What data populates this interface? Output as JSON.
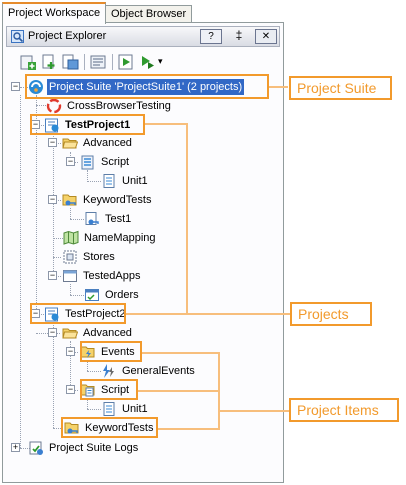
{
  "tabs": [
    {
      "label": "Project Workspace",
      "active": true
    },
    {
      "label": "Object Browser",
      "active": false
    }
  ],
  "panel": {
    "title": "Project Explorer",
    "help_label": "?",
    "pin_glyph": "‡",
    "close_glyph": "✕"
  },
  "toolbar": {
    "buttons": [
      "add-item-icon",
      "add-new-icon",
      "add-existing-icon",
      "properties-icon",
      "run-icon",
      "run-dropdown-icon"
    ],
    "dropdown_glyph": "▾"
  },
  "tree": {
    "suite": {
      "label": "Project Suite 'ProjectSuite1' (2 projects)",
      "expander": "−"
    },
    "crossbrowser": {
      "label": "CrossBrowserTesting"
    },
    "project1": {
      "label": "TestProject1",
      "expander": "−",
      "advanced": {
        "label": "Advanced",
        "expander": "−"
      },
      "script": {
        "label": "Script",
        "expander": "−"
      },
      "unit1": {
        "label": "Unit1"
      },
      "keywordtests": {
        "label": "KeywordTests",
        "expander": "−"
      },
      "test1": {
        "label": "Test1"
      },
      "namemapping": {
        "label": "NameMapping"
      },
      "stores": {
        "label": "Stores",
        "expander": "+"
      },
      "testedapps": {
        "label": "TestedApps",
        "expander": "−"
      },
      "orders": {
        "label": "Orders"
      }
    },
    "project2": {
      "label": "TestProject2",
      "expander": "−",
      "advanced": {
        "label": "Advanced",
        "expander": "−"
      },
      "events": {
        "label": "Events",
        "expander": "−"
      },
      "generalevents": {
        "label": "GeneralEvents"
      },
      "script": {
        "label": "Script",
        "expander": "−"
      },
      "unit1": {
        "label": "Unit1"
      },
      "keywordtests": {
        "label": "KeywordTests",
        "expander": "+"
      }
    },
    "logs": {
      "label": "Project Suite Logs",
      "expander": "+"
    }
  },
  "callouts": {
    "suite": "Project Suite",
    "projects": "Projects",
    "items": "Project Items"
  },
  "colors": {
    "accent_orange": "#f29a2c",
    "selection_blue": "#3168c6",
    "connector_orange": "#f7be7c"
  }
}
